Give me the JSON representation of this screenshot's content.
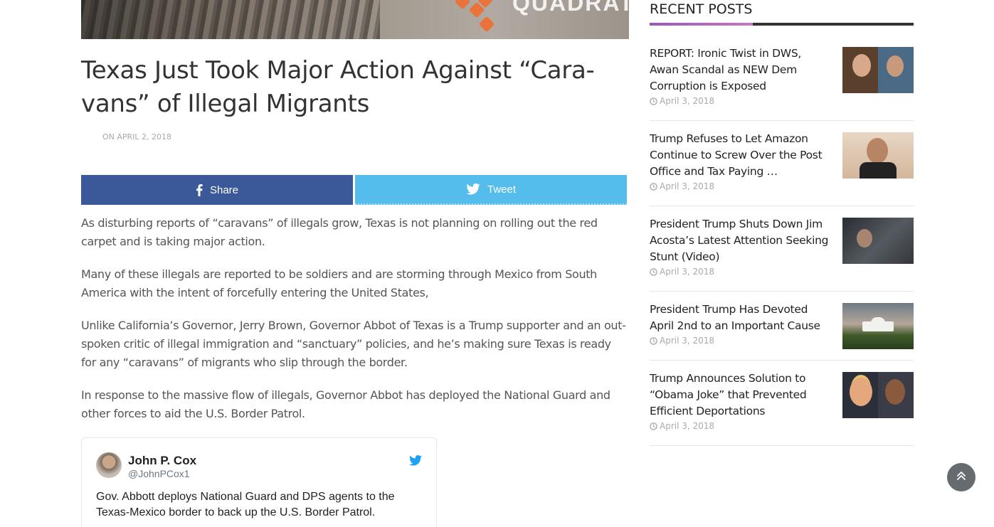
{
  "hero": {
    "brand_text": "QUADRATIN"
  },
  "article": {
    "title": "Texas Just Took Major Action Against “Cara­vans” of Illegal Migrants",
    "meta": "ON APRIL 2, 2018",
    "paragraphs": [
      "As disturbing reports of “caravans” of illegals grow, Texas is not planning on rolling out the red carpet and is taking major action.",
      "Many of these illegals are reported to be soldiers and are storming through Mexico from South America with the intent of forcefully entering the United States,",
      "Unlike California’s Governor, Jerry Brown, Governor Abbot of Texas is a Trump supporter and an out­spoken critic of illegal immigration and “sanctuary” policies, and he’s making sure Texas is ready for any “caravans” of migrants who slip through the border.",
      "In response to the massive flow of illegals, Governor Abbot has deployed the National Guard and other forces to aid the U.S. Border Patrol."
    ]
  },
  "share": {
    "facebook_label": "Share",
    "twitter_label": "Tweet",
    "facebook_color": "#3b5998",
    "twitter_color": "#55bdec"
  },
  "tweet": {
    "name": "John P. Cox",
    "handle": "@JohnPCox1",
    "text": "Gov. Abbott deploys National Guard and DPS agents to the Texas-Mexico border to back up the U.S. Border Patrol."
  },
  "sidebar": {
    "title": "RECENT POSTS",
    "accent_color": "#9b59b6",
    "posts": [
      {
        "title": "REPORT: Ironic Twist in DWS, Awan Scandal as NEW Dem Corruption is Exposed",
        "date": "April 3, 2018"
      },
      {
        "title": "Trump Refuses to Let Amazon Continue to Screw Over the Post Office and Tax Paying …",
        "date": "April 3, 2018"
      },
      {
        "title": "President Trump Shuts Down Jim Acosta’s Latest Attention Seeking Stunt (Video)",
        "date": "April 3, 2018"
      },
      {
        "title": "President Trump Has Devoted April 2nd to an Important Cause",
        "date": "April 3, 2018"
      },
      {
        "title": "Trump Announces Solution to “Obama Joke” that Prevented Efficient Deportations",
        "date": "April 3, 2018"
      }
    ]
  },
  "icons": {
    "facebook": "facebook-icon",
    "twitter": "twitter-bird-icon",
    "clock": "clock-icon",
    "scroll_top": "double-chevron-up-icon"
  }
}
